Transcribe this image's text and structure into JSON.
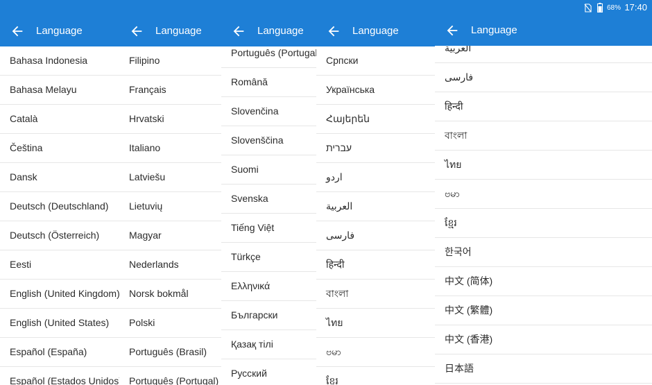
{
  "colors": {
    "appbar": "#1e7fd6",
    "text": "#2b2b2b",
    "divider": "#e6e6e6"
  },
  "status_bar": {
    "battery": "68%",
    "time": "17:40",
    "icons": [
      "no-sim-icon",
      "battery-icon"
    ]
  },
  "screens": [
    {
      "title": "Language",
      "back_icon": "arrow-left-icon",
      "items": [
        "Bahasa Indonesia",
        "Bahasa Melayu",
        "Català",
        "Čeština",
        "Dansk",
        "Deutsch (Deutschland)",
        "Deutsch (Österreich)",
        "Eesti",
        "English (United Kingdom)",
        "English (United States)",
        "Español (España)",
        "Español (Estados Unidos)"
      ]
    },
    {
      "title": "Language",
      "back_icon": "arrow-left-icon",
      "items": [
        "Filipino",
        "Français",
        "Hrvatski",
        "Italiano",
        "Latviešu",
        "Lietuvių",
        "Magyar",
        "Nederlands",
        "Norsk bokmål",
        "Polski",
        "Português (Brasil)",
        "Português (Portugal)"
      ]
    },
    {
      "title": "Language",
      "back_icon": "arrow-left-icon",
      "items": [
        "Português (Portugal)",
        "Română",
        "Slovenčina",
        "Slovenščina",
        "Suomi",
        "Svenska",
        "Tiếng Việt",
        "Türkçe",
        "Ελληνικά",
        "Български",
        "Қазақ тілі",
        "Русский"
      ]
    },
    {
      "title": "Language",
      "back_icon": "arrow-left-icon",
      "items": [
        "Српски",
        "Українська",
        "Հայերեն",
        "עברית",
        "اردو",
        "العربية",
        "فارسی",
        "हिन्दी",
        "বাংলা",
        "ไทย",
        "ဗမာ",
        "ខ្មែរ"
      ]
    },
    {
      "title": "Language",
      "back_icon": "arrow-left-icon",
      "items": [
        "العربية",
        "فارسی",
        "हिन्दी",
        "বাংলা",
        "ไทย",
        "ဗမာ",
        "ខ្មែរ",
        "한국어",
        "中文 (简体)",
        "中文 (繁體)",
        "中文 (香港)",
        "日本語"
      ]
    }
  ]
}
